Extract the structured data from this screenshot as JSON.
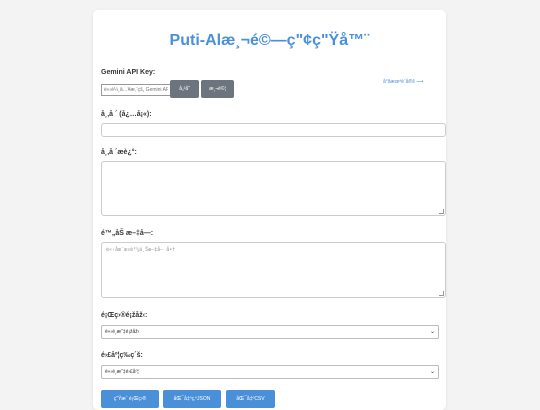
{
  "app": {
    "title": "Puti-Alæ¸¬é©—ç\"¢ç\"Ÿå™¨"
  },
  "api": {
    "label": "Gemini API Key:",
    "input_placeholder": "è«‹è¼¸å…¥æ‚¨çš„ Gemini API Key",
    "save_label": "å„²å­˜",
    "test_label": "æ¸¬è©¦",
    "status_text": "å°šæœªè¨­å®š ⟶"
  },
  "field1": {
    "label": "å¸‚å ´ (å¿…å¡«):"
  },
  "field2": {
    "label": "å¸‚å ´æè¿°:"
  },
  "field3": {
    "label": "é™„åŠ æ–‡å­—:",
    "placeholder": "è«‹åœ¨æ­¤è²¼ä¸Šæ–‡å­—  å•†"
  },
  "select1": {
    "label": "é¡Œç›®é¡žåž‹:",
    "value": "è«‹é¸æ“‡é¡žåž‹"
  },
  "select2": {
    "label": "é›£åº¦ç­‰ç´š:",
    "value": "è«‹é¸æ“‡é›£åº¦"
  },
  "actions": {
    "generate_label": "ç\"Ÿæˆ  é¡Œç›®",
    "export_label": "åŒ¯å‡ºç‚ºJSON",
    "csv_label": "åŒ¯å‡ºCSV"
  }
}
